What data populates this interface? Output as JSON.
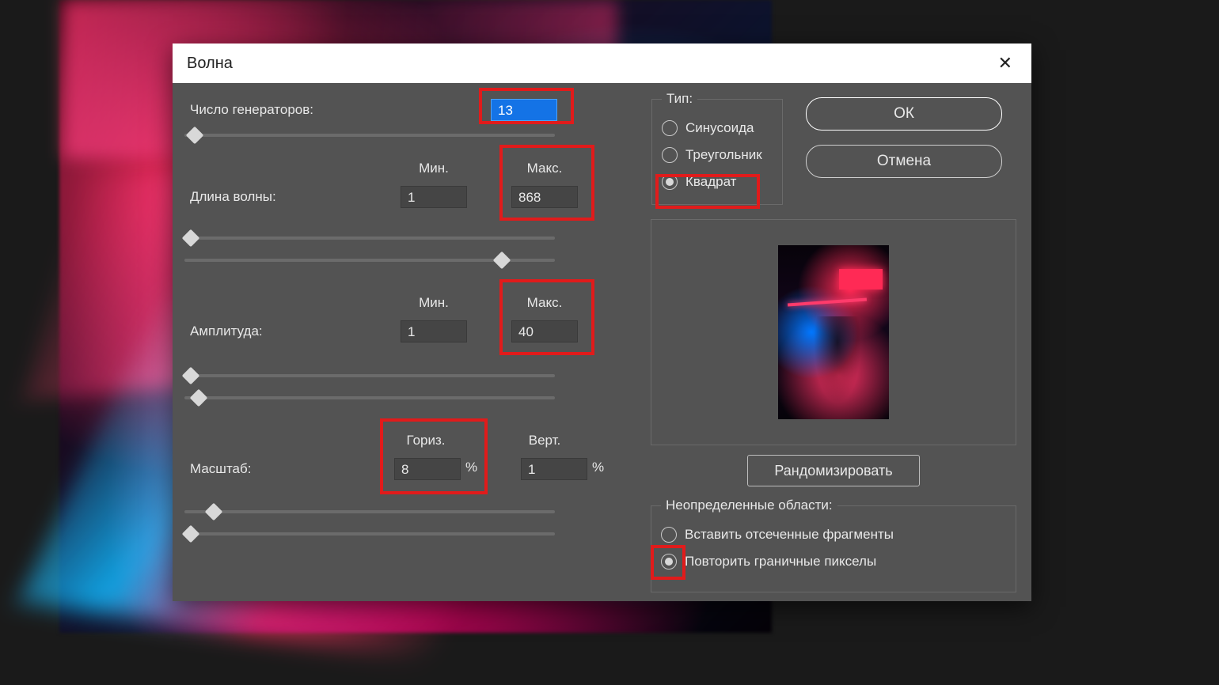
{
  "dialog_title": "Волна",
  "labels": {
    "generators": "Число генераторов:",
    "wavelength": "Длина волны:",
    "amplitude": "Амплитуда:",
    "scale": "Масштаб:",
    "min": "Мин.",
    "max": "Макс.",
    "horiz": "Гориз.",
    "vert": "Верт."
  },
  "values": {
    "generators": "13",
    "wavelength_min": "1",
    "wavelength_max": "868",
    "amplitude_min": "1",
    "amplitude_max": "40",
    "scale_h": "8",
    "scale_v": "1"
  },
  "percent": "%",
  "type_group": {
    "legend": "Тип:",
    "options": [
      "Синусоида",
      "Треугольник",
      "Квадрат"
    ],
    "selected": 2
  },
  "undef_group": {
    "legend": "Неопределенные области:",
    "options": [
      "Вставить отсеченные фрагменты",
      "Повторить граничные пикселы"
    ],
    "selected": 1
  },
  "buttons": {
    "ok": "ОК",
    "cancel": "Отмена",
    "randomize": "Рандомизировать"
  }
}
